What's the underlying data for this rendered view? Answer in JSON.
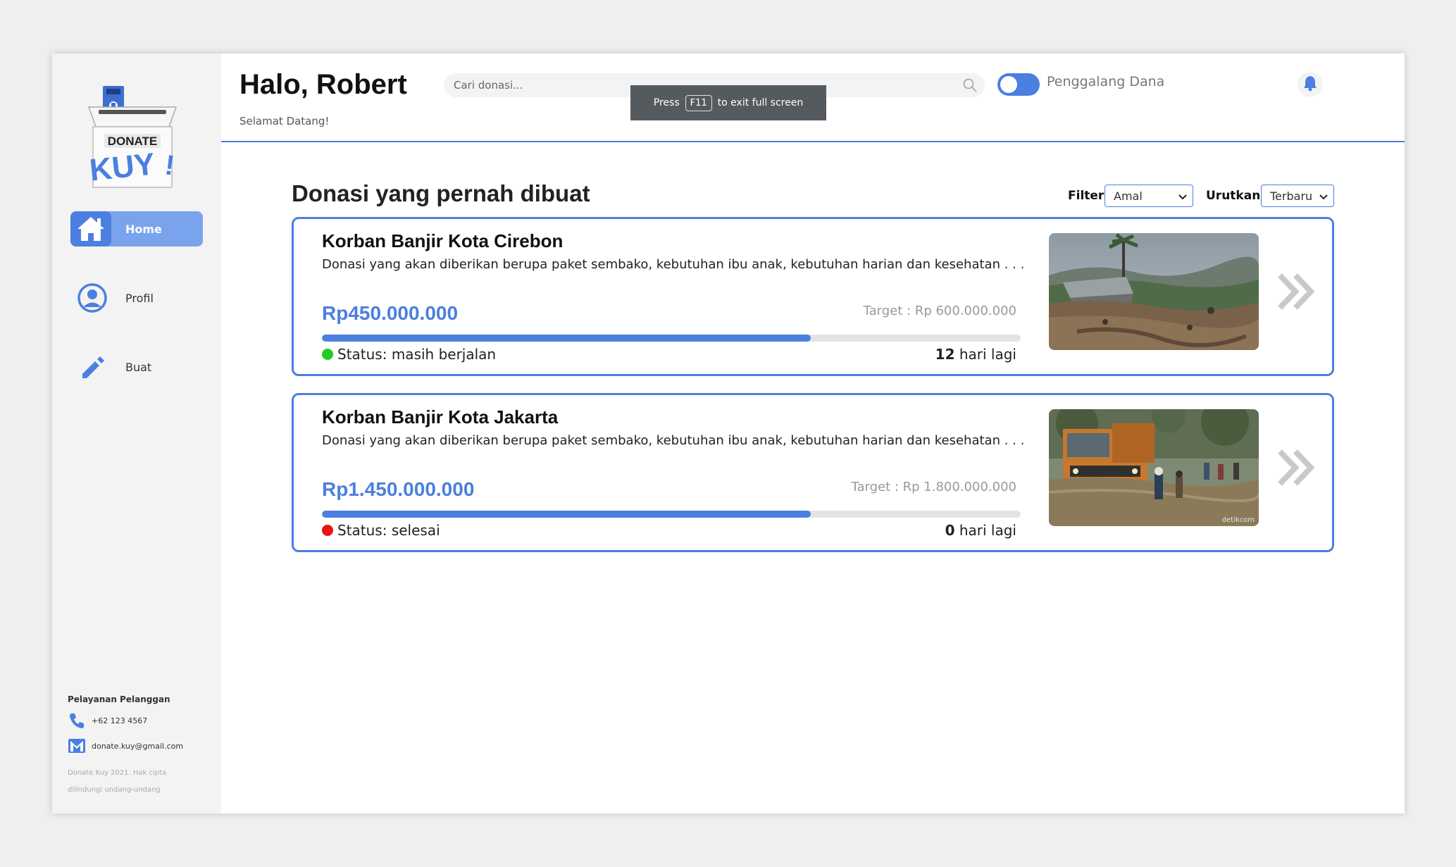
{
  "header": {
    "greeting": "Halo, Robert",
    "subtitle": "Selamat Datang!",
    "search_placeholder": "Cari donasi...",
    "toggle_label": "Penggalang Dana",
    "toggle_on": true
  },
  "fullscreen_toast": {
    "press": "Press",
    "key": "F11",
    "suffix": "to exit full screen"
  },
  "logo": {
    "line1": "DONATE",
    "line2": "KUY",
    "mark": "!"
  },
  "sidebar": {
    "items": [
      {
        "label": "Home",
        "icon": "home-icon",
        "active": true
      },
      {
        "label": "Profil",
        "icon": "user-icon",
        "active": false
      },
      {
        "label": "Buat",
        "icon": "pencil-icon",
        "active": false
      }
    ]
  },
  "footer": {
    "title": "Pelayanan Pelanggan",
    "phone": "+62 123 4567",
    "email": "donate.kuy@gmail.com",
    "copyright_line1": "Donate Kuy 2021. Hak cipta",
    "copyright_line2": "dilindungi undang-undang"
  },
  "main": {
    "title": "Donasi yang pernah dibuat",
    "filter_label": "Filter:",
    "filter_value": "Amal",
    "sort_label": "Urutkan:",
    "sort_value": "Terbaru",
    "cards": [
      {
        "title": "Korban Banjir Kota Cirebon",
        "description": "Donasi yang akan diberikan berupa paket sembako, kebutuhan ibu anak, kebutuhan harian dan kesehatan . . .",
        "amount": "Rp450.000.000",
        "target": "Target : Rp 600.000.000",
        "progress": 0.7,
        "status": "Status: masih berjalan",
        "status_color": "#22cc22",
        "days_num": "12",
        "days_text": " hari lagi"
      },
      {
        "title": "Korban Banjir Kota Jakarta",
        "description": "Donasi yang akan diberikan berupa paket sembako, kebutuhan ibu anak, kebutuhan harian dan kesehatan . . .",
        "amount": "Rp1.450.000.000",
        "target": "Target : Rp 1.800.000.000",
        "progress": 0.7,
        "status": "Status: selesai",
        "status_color": "#ee1111",
        "days_num": "0",
        "days_text": " hari lagi",
        "photo_watermark": "detikcom"
      }
    ]
  },
  "colors": {
    "accent": "#4b7fe0",
    "accent_light": "#7aa3ee",
    "sidebar_bg": "#f3f3f3"
  }
}
